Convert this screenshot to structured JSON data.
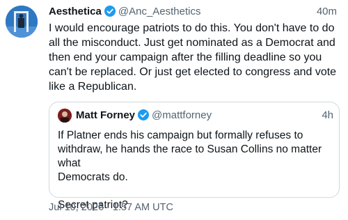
{
  "tweet": {
    "author_name": "Aesthetica",
    "handle": "@Anc_Aesthetics",
    "time_ago": "40m",
    "text": "I would encourage patriots to do this. You don't have to do\nall the misconduct. Just get nominated as a Democrat and\nthen end your campaign after the filling deadline so you\ncan't be replaced. Or just get elected to congress and vote\nlike a Republican.",
    "verified_icon": "verified-badge-icon",
    "colors": {
      "verified": "#1d9bf0",
      "secondary_text": "#536471",
      "border": "#cfd9de"
    }
  },
  "quote": {
    "author_name": "Matt Forney",
    "handle": "@mattforney",
    "time_ago": "4h",
    "text": "If Platner ends his campaign but formally refuses to\nwithdraw, he hands the race to Susan Collins no matter what\nDemocrats do.\n\nSecret patriot?"
  },
  "footer": {
    "timestamp": "Jul 10, 2026 · 1:57 AM UTC"
  }
}
